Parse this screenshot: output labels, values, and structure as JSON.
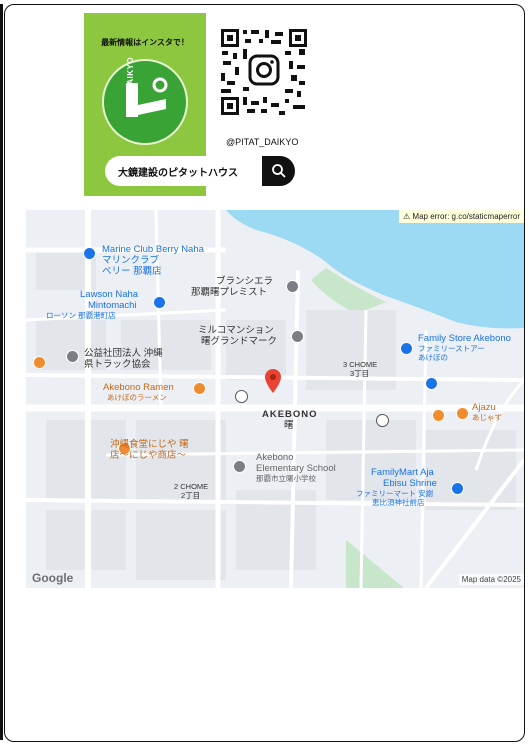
{
  "promo": {
    "title": "最新情報はインスタで！",
    "logo_text": "DAIKYO",
    "search_label": "大鏡建設のピタットハウス",
    "sub_label": "ﾋﾟﾀｯﾄﾊｳｽ",
    "handle": "@PITAT_DAIKYO"
  },
  "map": {
    "error": "Map error: g.co/staticmaperror",
    "attribution": "Map data ©2025",
    "brand": "Google",
    "labels": {
      "marine": "Marine Club Berry Naha",
      "marine_jp1": "マリンクラブ",
      "marine_jp2": "ベリー 那覇店",
      "lawson1": "Lawson Naha",
      "lawson2": "Mintomachi",
      "lawson_jp": "ローソン 那覇港町店",
      "francia1": "ブランシエラ",
      "francia2": "那覇曙プレミスト",
      "milcom1": "ミルコマンション",
      "milcom2": "曙グランドマーク",
      "assoc1": "公益社団法人 沖縄",
      "assoc2": "県トラック協会",
      "chome3": "3 CHOME",
      "chome3_jp": "3丁目",
      "family_store": "Family Store Akebono",
      "family_store_jp1": "ファミリーストアー",
      "family_store_jp2": "あけぼの",
      "ramen": "Akebono Ramen",
      "ramen_jp": "あけぼのラーメン",
      "akebono": "AKEBONO",
      "akebono_jp": "曙",
      "ajazu": "Ajazu",
      "ajazu_jp": "あじゃず",
      "shokudo1": "沖縄食堂にじや 曙",
      "shokudo2": "店～にじや商店～",
      "school1": "Akebono",
      "school2": "Elementary School",
      "school_jp": "那覇市立曙小学校",
      "chome2": "2 CHOME",
      "chome2_jp": "2丁目",
      "fm1": "FamilyMart Aja",
      "fm2": "Ebisu Shrine",
      "fm_jp1": "ファミリーマート 安謝",
      "fm_jp2": "恵比須神社前店"
    }
  }
}
